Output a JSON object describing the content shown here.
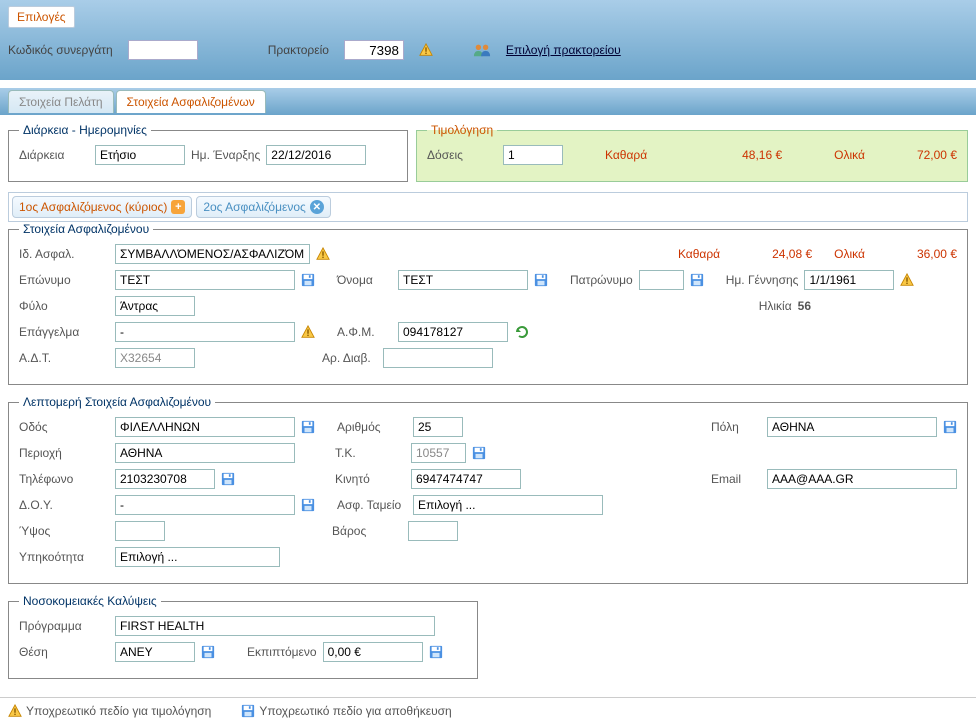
{
  "header": {
    "options_label": "Επιλογές",
    "partner_code_label": "Κωδικός συνεργάτη",
    "partner_code": "",
    "agency_label": "Πρακτορείο",
    "agency_value": "7398",
    "pick_agency_label": "Επιλογή πρακτορείου"
  },
  "tabs": {
    "client_data": "Στοιχεία Πελάτη",
    "insured_data": "Στοιχεία Ασφαλιζομένων"
  },
  "duration": {
    "legend": "Διάρκεια - Ημερομηνίες",
    "duration_label": "Διάρκεια",
    "duration_value": "Ετήσιο",
    "start_label": "Ημ. Έναρξης",
    "start_value": "22/12/2016"
  },
  "pricing": {
    "legend": "Τιμολόγηση",
    "installments_label": "Δόσεις",
    "installments_value": "1",
    "net_label": "Καθαρά",
    "net_value": "48,16 €",
    "total_label": "Ολικά",
    "total_value": "72,00 €"
  },
  "ins_tabs": {
    "first": "1ος Ασφαλιζόμενος (κύριος)",
    "second": "2ος Ασφαλιζόμενος"
  },
  "insured": {
    "legend": "Στοιχεία Ασφαλιζομένου",
    "id_label": "Ιδ. Ασφαλ.",
    "id_value": "ΣΥΜΒΑΛΛΌΜΕΝΟΣ/ΑΣΦΑΛΙΖΌΜΕ",
    "row_net_label": "Καθαρά",
    "row_net_value": "24,08 €",
    "row_total_label": "Ολικά",
    "row_total_value": "36,00 €",
    "lastname_label": "Επώνυμο",
    "lastname_value": "ΤΕΣΤ",
    "firstname_label": "Όνομα",
    "firstname_value": "ΤΕΣΤ",
    "fathername_label": "Πατρώνυμο",
    "fathername_value": "",
    "birth_label": "Ημ. Γέννησης",
    "birth_value": "1/1/1961",
    "gender_label": "Φύλο",
    "gender_value": "Άντρας",
    "age_label": "Ηλικία",
    "age_value": "56",
    "job_label": "Επάγγελμα",
    "job_value": "-",
    "afm_label": "Α.Φ.Μ.",
    "afm_value": "094178127",
    "adt_label": "Α.Δ.Τ.",
    "adt_value": "X32654",
    "passport_label": "Αρ. Διαβ.",
    "passport_value": ""
  },
  "details": {
    "legend": "Λεπτομερή Στοιχεία Ασφαλιζομένου",
    "street_label": "Οδός",
    "street_value": "ΦΙΛΕΛΛΗΝΩΝ",
    "number_label": "Αριθμός",
    "number_value": "25",
    "city_label": "Πόλη",
    "city_value": "ΑΘΗΝΑ",
    "region_label": "Περιοχή",
    "region_value": "ΑΘΗΝΑ",
    "zip_label": "Τ.Κ.",
    "zip_value": "10557",
    "phone_label": "Τηλέφωνο",
    "phone_value": "2103230708",
    "mobile_label": "Κινητό",
    "mobile_value": "6947474747",
    "email_label": "Email",
    "email_value": "AAA@AAA.GR",
    "doy_label": "Δ.Ο.Υ.",
    "doy_value": "-",
    "fund_label": "Ασφ. Ταμείο",
    "fund_value": "Επιλογή ...",
    "height_label": "Ύψος",
    "height_value": "",
    "weight_label": "Βάρος",
    "weight_value": "",
    "nationality_label": "Υπηκοότητα",
    "nationality_value": "Επιλογή ..."
  },
  "hospital": {
    "legend": "Νοσοκομειακές Καλύψεις",
    "program_label": "Πρόγραμμα",
    "program_value": "FIRST HEALTH",
    "class_label": "Θέση",
    "class_value": "ΑΝΕΥ",
    "deductible_label": "Εκπιπτόμενο",
    "deductible_value": "0,00 €"
  },
  "footer": {
    "req_pricing": "Υποχρεωτικό πεδίο για τιμολόγηση",
    "req_save": "Υποχρεωτικό πεδίο για αποθήκευση"
  }
}
